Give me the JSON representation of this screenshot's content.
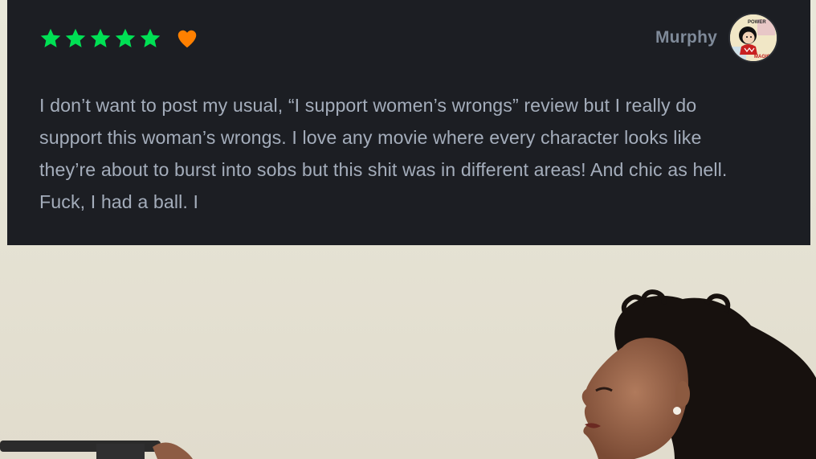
{
  "review": {
    "rating_stars": 5,
    "liked": true,
    "reviewer_name": "Murphy",
    "text": "I don’t want to post my usual, “I support women’s wrongs” review but I really do support this woman’s wrongs. I love any movie where every character looks like they’re about to burst into sobs but this shit was in different areas! And chic as hell. Fuck, I had a ball. I",
    "avatar_text_top": "POWER",
    "avatar_text_bottom": "MAGIC"
  },
  "colors": {
    "card_background": "#1c1e23",
    "star": "#00e054",
    "heart": "#ff8000",
    "reviewer_name": "#7f8a99",
    "review_text": "#a4adbb",
    "sky": "#e6e4d6"
  },
  "icons": {
    "star": "star-icon",
    "heart": "heart-icon"
  }
}
